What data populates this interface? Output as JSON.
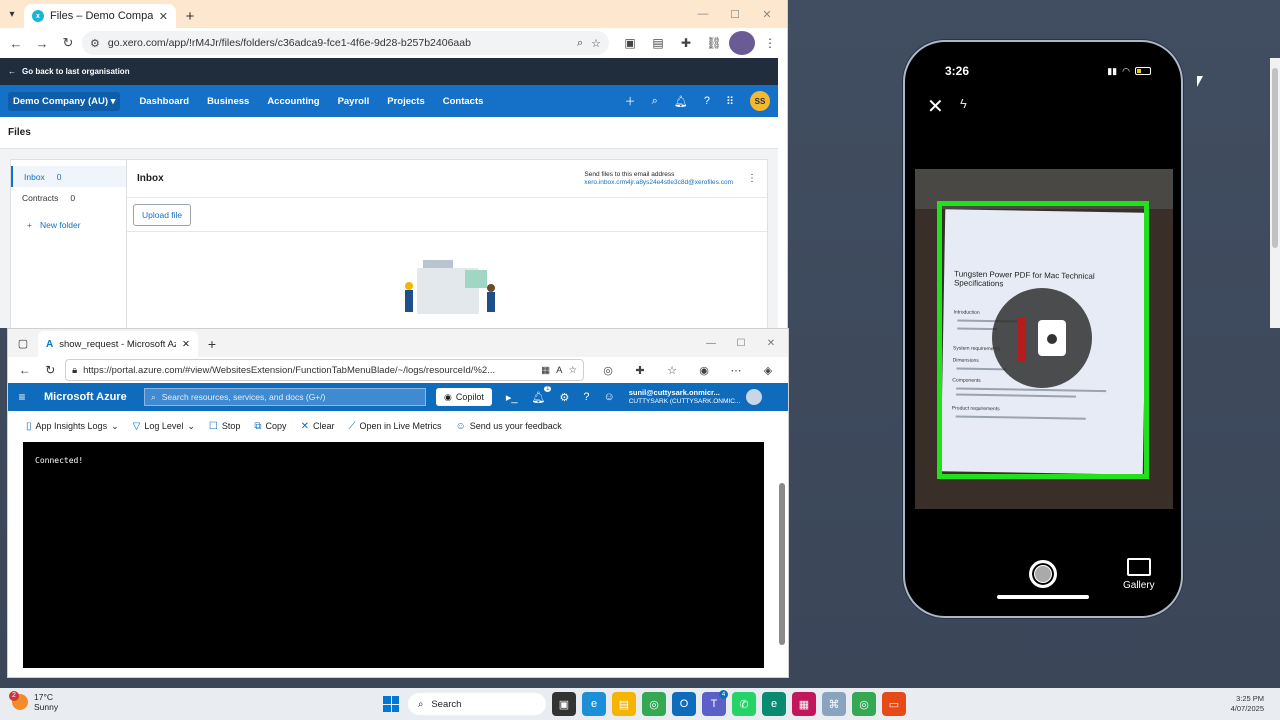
{
  "chrome": {
    "tab_title": "Files – Demo Company (AU) – X",
    "url": "go.xero.com/app/!rM4Jr/files/folders/c36adca9-fce1-4f6e-9d28-b257b2406aab"
  },
  "xero": {
    "back_link": "Go back to last organisation",
    "org_name": "Demo Company (AU)",
    "nav": [
      "Dashboard",
      "Business",
      "Accounting",
      "Payroll",
      "Projects",
      "Contacts"
    ],
    "avatar_initials": "SS",
    "page_title": "Files",
    "sidebar": [
      {
        "label": "Inbox",
        "count": "0"
      },
      {
        "label": "Contracts",
        "count": "0"
      }
    ],
    "new_folder": "New folder",
    "main_title": "Inbox",
    "email_label": "Send files to this email address",
    "email_address": "xero.inbox.crm4jr.a8ys24e4stle3c8d@xerofiles.com",
    "upload_button": "Upload file"
  },
  "edge": {
    "tab_title": "show_request - Microsoft Azure",
    "url": "https://portal.azure.com/#view/WebsitesExtension/FunctionTabMenuBlade/~/logs/resourceId/%2..."
  },
  "azure": {
    "brand": "Microsoft Azure",
    "search_placeholder": "Search resources, services, and docs (G+/)",
    "copilot": "Copilot",
    "notification_count": "1",
    "user_email": "sunil@cuttysark.onmicr...",
    "user_tenant": "CUTTYSARK (CUTTYSARK.ONMIC...",
    "commands": {
      "logs": "App Insights Logs",
      "level": "Log Level",
      "stop": "Stop",
      "copy": "Copy",
      "clear": "Clear",
      "live": "Open in Live Metrics",
      "feedback": "Send us your feedback"
    },
    "console_text": "Connected!"
  },
  "phone": {
    "time": "3:26",
    "doc_title": "Tungsten Power PDF for Mac Technical Specifications",
    "doc_sections": [
      "Introduction",
      "System requirements",
      "Dimensions",
      "Components",
      "Product requirements"
    ],
    "gallery": "Gallery",
    "frame_color": "#22e01c"
  },
  "taskbar": {
    "temperature": "17°C",
    "weather": "Sunny",
    "weather_badge": "2",
    "search": "Search",
    "time": "3:25 PM",
    "date": "4/07/2025",
    "teams_badge": "4"
  }
}
